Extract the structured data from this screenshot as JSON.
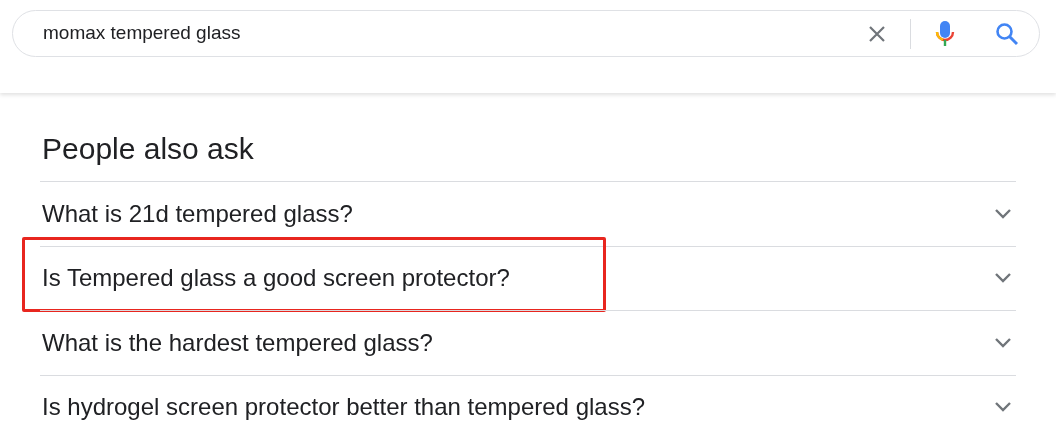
{
  "search": {
    "value": "momax tempered glass"
  },
  "people_also_ask": {
    "title": "People also ask",
    "questions": [
      {
        "text": "What is 21d tempered glass?",
        "highlighted": false
      },
      {
        "text": "Is Tempered glass a good screen protector?",
        "highlighted": true
      },
      {
        "text": "What is the hardest tempered glass?",
        "highlighted": false
      },
      {
        "text": "Is hydrogel screen protector better than tempered glass?",
        "highlighted": false
      }
    ]
  }
}
